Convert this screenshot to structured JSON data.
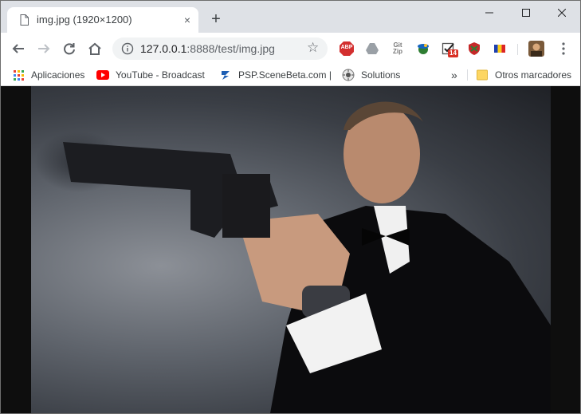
{
  "tab": {
    "title": "img.jpg (1920×1200)",
    "close_glyph": "×"
  },
  "newtab": {
    "label": "+"
  },
  "address": {
    "host": "127.0.0.1",
    "rest": ":8888/test/img.jpg"
  },
  "extensions": {
    "abp_label": "ABP",
    "gitzip_label": "Git Zip",
    "badge_count": "14"
  },
  "bookmarks": [
    {
      "label": "Aplicaciones",
      "icon": "apps-grid-icon"
    },
    {
      "label": "YouTube - Broadcast",
      "icon": "youtube-icon"
    },
    {
      "label": "PSP.SceneBeta.com |",
      "icon": "pspscenebeta-icon"
    },
    {
      "label": "Solutions",
      "icon": "solutions-icon"
    }
  ],
  "bookmarks_overflow": "»",
  "other_bookmarks": {
    "label": "Otros marcadores",
    "icon": "folder-icon"
  },
  "colors": {
    "tab_strip": "#dee1e6",
    "omnibox": "#f1f3f4",
    "viewport": "#0e0e0e",
    "abp": "#d32f2f",
    "youtube": "#ff0000"
  }
}
